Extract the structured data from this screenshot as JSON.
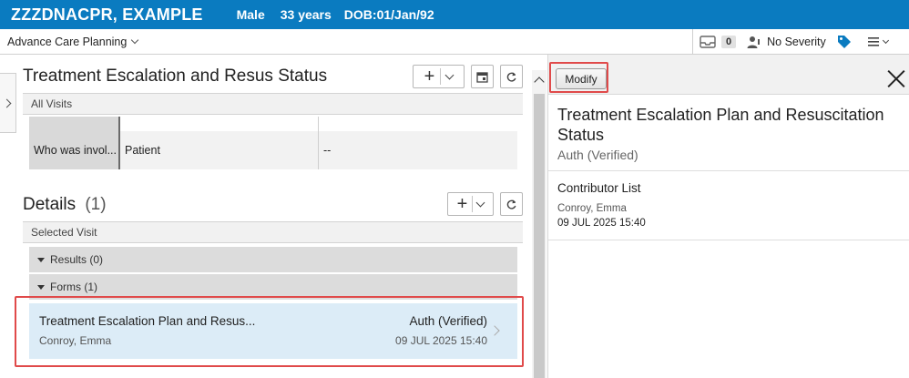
{
  "banner": {
    "patient_name": "ZZZDNACPR, EXAMPLE",
    "gender": "Male",
    "age": "33 years",
    "dob": "DOB:01/Jan/92"
  },
  "subheader": {
    "view_name": "Advance Care Planning",
    "message_count": "0",
    "severity": "No Severity"
  },
  "treatment_section": {
    "title": "Treatment Escalation and Resus Status",
    "filter": "All Visits",
    "table_row": {
      "label": "Who was invol...",
      "value": "Patient",
      "extra": "--"
    }
  },
  "details_section": {
    "title": "Details",
    "count": "(1)",
    "filter": "Selected Visit",
    "groups": [
      {
        "label": "Results (0)"
      },
      {
        "label": "Forms (1)"
      }
    ],
    "card": {
      "title": "Treatment Escalation Plan and Resus...",
      "author": "Conroy, Emma",
      "status": "Auth (Verified)",
      "datetime": "09 JUL 2025 15:40"
    }
  },
  "right_panel": {
    "modify_label": "Modify",
    "title": "Treatment Escalation Plan and Resuscitation Status",
    "status": "Auth (Verified)",
    "contributor_heading": "Contributor List",
    "contributor_name": "Conroy, Emma",
    "contributor_datetime": "09 JUL 2025 15:40"
  },
  "colors": {
    "banner": "#0a7bc0",
    "highlight_border": "#e04a4a",
    "selected_card": "#dcecf7"
  }
}
